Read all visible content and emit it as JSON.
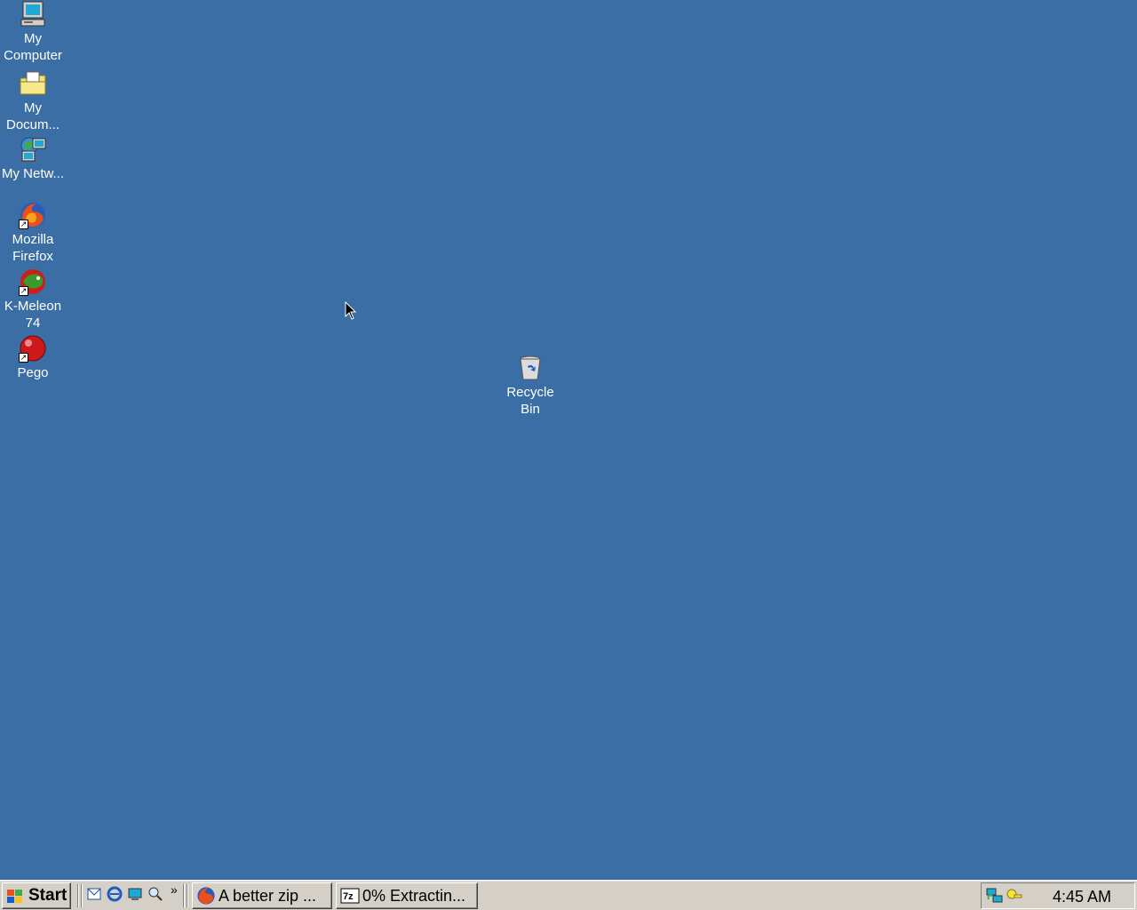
{
  "desktop": {
    "background_color": "#3a6ea5",
    "icons": [
      {
        "label": "My Computer",
        "icon": "my-computer-icon"
      },
      {
        "label": "My Docum...",
        "icon": "my-documents-icon"
      },
      {
        "label": "My Netw...",
        "icon": "my-network-places-icon"
      },
      {
        "label": "Mozilla Firefox",
        "icon": "firefox-icon"
      },
      {
        "label": "K-Meleon 74",
        "icon": "k-meleon-icon"
      },
      {
        "label": "Pego",
        "icon": "pego-icon"
      },
      {
        "label": "Recycle Bin",
        "icon": "recycle-bin-icon"
      }
    ]
  },
  "taskbar": {
    "start_label": "Start",
    "quick_launch": [
      "outlook-express-icon",
      "internet-explorer-icon",
      "show-desktop-icon",
      "search-icon"
    ],
    "chevron": "»",
    "tasks": [
      {
        "label": "A better zip ...",
        "icon": "firefox-icon"
      },
      {
        "label": "0% Extractin...",
        "icon": "7zip-icon"
      }
    ],
    "clock": "4:45 AM"
  }
}
